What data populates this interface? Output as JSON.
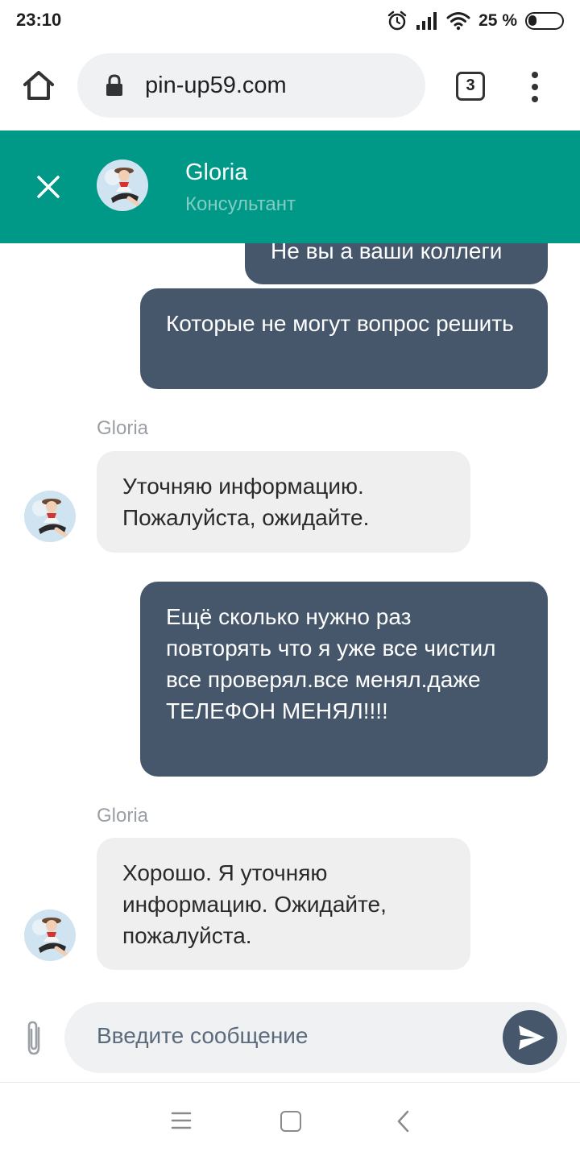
{
  "status_bar": {
    "time": "23:10",
    "battery_percent": "25 %",
    "battery_level": 0.25,
    "icons": [
      "alarm-icon",
      "signal-icon",
      "wifi-icon",
      "battery-icon"
    ]
  },
  "browser": {
    "url": "pin-up59.com",
    "tab_count": "3",
    "icons": [
      "home-icon",
      "lock-icon",
      "tabs-icon",
      "more-vert-icon"
    ]
  },
  "chat_header": {
    "agent_name": "Gloria",
    "agent_role": "Консультант",
    "accent_color": "#009886"
  },
  "messages": [
    {
      "direction": "out",
      "text": "Не вы а ваши коллеги"
    },
    {
      "direction": "out",
      "text": "Которые не могут вопрос решить"
    },
    {
      "direction": "in",
      "sender": "Gloria",
      "text": "Уточняю информацию. Пожалуйста, ожидайте."
    },
    {
      "direction": "out",
      "text": "Ещё сколько нужно раз повторять что я уже все чистил все проверял.все менял.даже ТЕЛЕФОН МЕНЯЛ!!!!"
    },
    {
      "direction": "in",
      "sender": "Gloria",
      "text": "Хорошо. Я уточняю информацию. Ожидайте, пожалуйста."
    }
  ],
  "input": {
    "placeholder": "Введите сообщение"
  },
  "colors": {
    "outgoing_bubble": "#46576c",
    "incoming_bubble": "#efefef",
    "header": "#009886"
  }
}
